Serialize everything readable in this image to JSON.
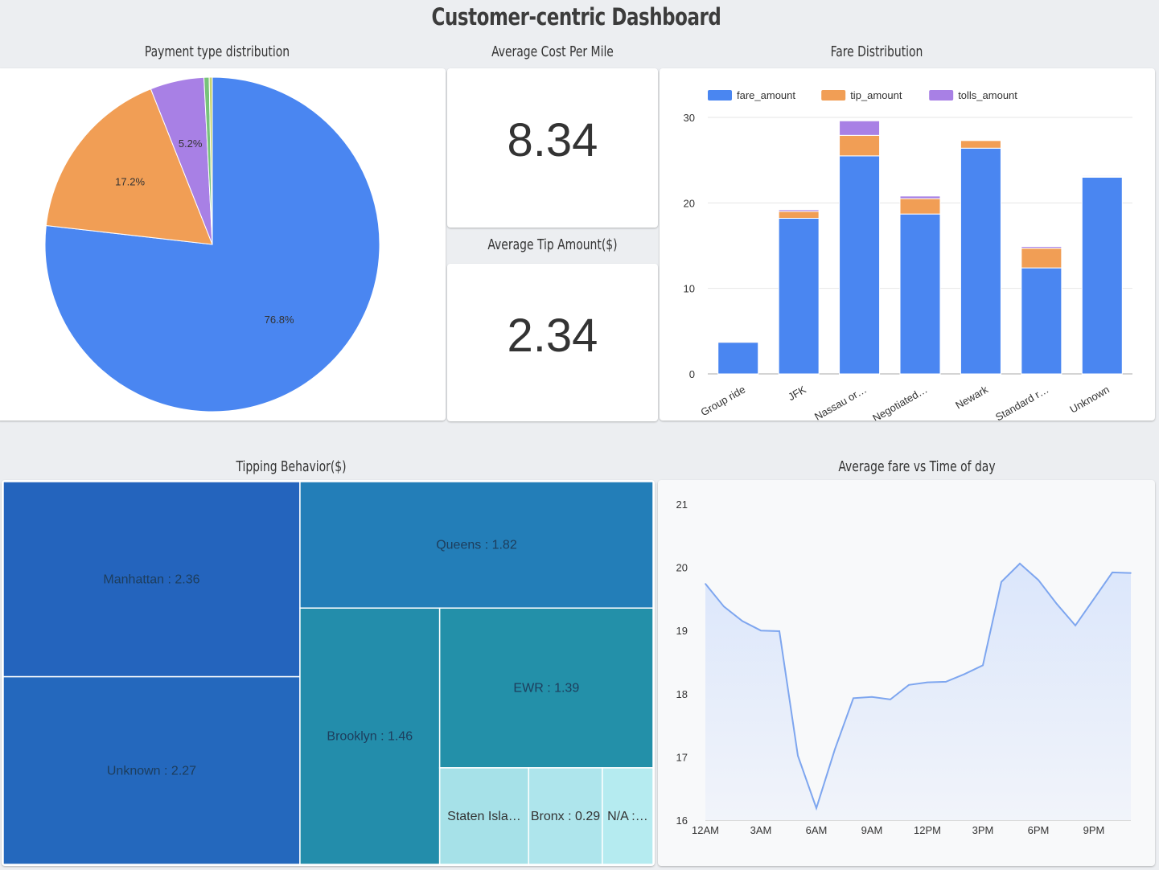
{
  "dashboard": {
    "title": "Customer-centric Dashboard"
  },
  "panels": {
    "payment_title": "Payment type distribution",
    "cost_title": "Average Cost Per Mile",
    "tip_title": "Average Tip Amount($)",
    "fare_title": "Fare Distribution",
    "treemap_title": "Tipping Behavior($)",
    "time_title": "Average fare vs Time of day"
  },
  "scorecards": {
    "cost_per_mile": "8.34",
    "avg_tip": "2.34"
  },
  "colors": {
    "blue": "#4a86f1",
    "orange": "#f19e55",
    "purple": "#a880e5",
    "green": "#77c37a",
    "line": "#7ea6ef"
  },
  "chart_data": [
    {
      "type": "pie",
      "title": "Payment type distribution",
      "slices": [
        {
          "value": 76.8,
          "label": "76.8%",
          "color": "#4a86f1"
        },
        {
          "value": 17.2,
          "label": "17.2%",
          "color": "#f19e55"
        },
        {
          "value": 5.2,
          "label": "5.2%",
          "color": "#a880e5"
        },
        {
          "value": 0.5,
          "label": "",
          "color": "#77c37a"
        },
        {
          "value": 0.3,
          "label": "",
          "color": "#c8d36f"
        }
      ]
    },
    {
      "type": "bar",
      "stacked": true,
      "title": "Fare Distribution",
      "categories": [
        "Group ride",
        "JFK",
        "Nassau or…",
        "Negotiated…",
        "Newark",
        "Standard r…",
        "Unknown"
      ],
      "series": [
        {
          "name": "fare_amount",
          "color": "#4a86f1",
          "values": [
            3.7,
            18.2,
            25.5,
            18.7,
            26.4,
            12.4,
            23.0
          ]
        },
        {
          "name": "tip_amount",
          "color": "#f19e55",
          "values": [
            0.1,
            0.8,
            2.4,
            1.8,
            0.9,
            2.3,
            0.1
          ]
        },
        {
          "name": "tolls_amount",
          "color": "#a880e5",
          "values": [
            0.05,
            0.2,
            1.7,
            0.3,
            0.05,
            0.2,
            0.1
          ]
        }
      ],
      "ylim": [
        0,
        30
      ],
      "yticks": [
        0,
        10,
        20,
        30
      ],
      "legend": "top-left"
    },
    {
      "type": "treemap",
      "title": "Tipping Behavior($)",
      "items": [
        {
          "label": "Manhattan : 2.36",
          "value": 2.36,
          "color": "#2464bd"
        },
        {
          "label": "Unknown : 2.27",
          "value": 2.27,
          "color": "#2468bd"
        },
        {
          "label": "Queens : 1.82",
          "value": 1.82,
          "color": "#237eb8"
        },
        {
          "label": "Brooklyn : 1.46",
          "value": 1.46,
          "color": "#238dab"
        },
        {
          "label": "EWR : 1.39",
          "value": 1.39,
          "color": "#2390a9"
        },
        {
          "label": "Staten Isla…",
          "value": 0.35,
          "color": "#a6e1e8"
        },
        {
          "label": "Bronx : 0.29",
          "value": 0.29,
          "color": "#aee5ec"
        },
        {
          "label": "N/A :…",
          "value": 0.2,
          "color": "#b5ebf0"
        }
      ]
    },
    {
      "type": "area",
      "title": "Average fare vs Time of day",
      "x": [
        0,
        1,
        2,
        3,
        4,
        5,
        6,
        7,
        8,
        9,
        10,
        11,
        12,
        13,
        14,
        15,
        16,
        17,
        18,
        19,
        20,
        21,
        22,
        23
      ],
      "values": [
        19.74,
        19.38,
        19.15,
        19.0,
        18.99,
        17.02,
        16.19,
        17.12,
        17.93,
        17.95,
        17.91,
        18.14,
        18.18,
        18.19,
        18.31,
        18.45,
        19.77,
        20.06,
        19.8,
        19.42,
        19.08,
        19.5,
        19.92,
        19.91
      ],
      "xticks": [
        "12AM",
        "3AM",
        "6AM",
        "9AM",
        "12PM",
        "3PM",
        "6PM",
        "9PM"
      ],
      "ylim": [
        16,
        21
      ],
      "yticks": [
        16,
        17,
        18,
        19,
        20,
        21
      ]
    }
  ]
}
